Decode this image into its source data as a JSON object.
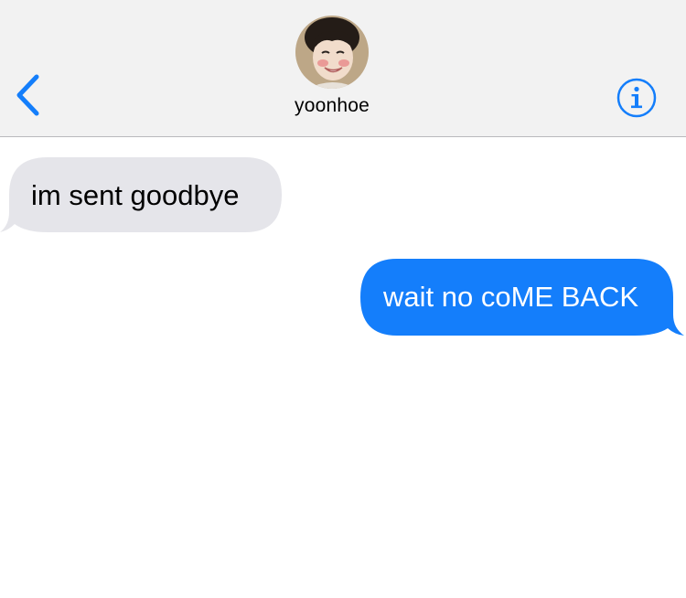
{
  "header": {
    "back_icon": "chevron-left-icon",
    "contact_name": "yoonhoe",
    "info_icon": "info-circle-icon",
    "accent_color": "#147efb"
  },
  "messages": [
    {
      "direction": "incoming",
      "text": "im sent goodbye",
      "bubble_color": "#e5e5ea",
      "text_color": "#000000"
    },
    {
      "direction": "outgoing",
      "text": "wait no coME BACK",
      "bubble_color": "#147efb",
      "text_color": "#ffffff"
    }
  ]
}
